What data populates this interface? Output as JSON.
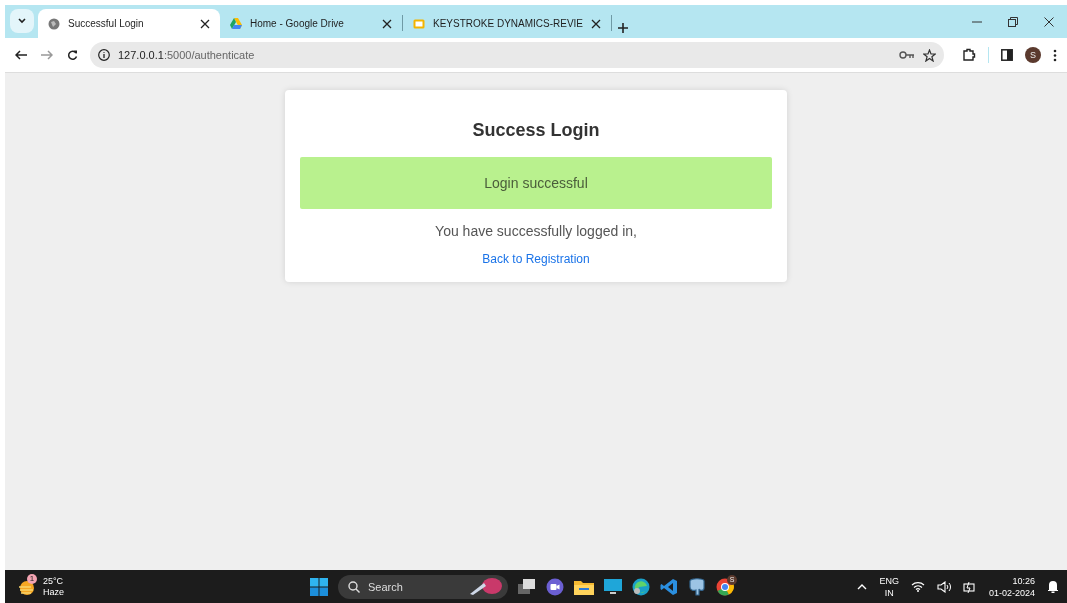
{
  "browser": {
    "tabs": [
      {
        "title": "Successful Login",
        "kind": "globe",
        "selected": true
      },
      {
        "title": "Home - Google Drive",
        "kind": "drive",
        "selected": false
      },
      {
        "title": "KEYSTROKE DYNAMICS-REVIE",
        "kind": "slides",
        "selected": false
      }
    ],
    "address": {
      "host": "127.0.0.1",
      "path": ":5000/authenticate"
    },
    "profile_initial": "S"
  },
  "page": {
    "heading": "Success Login",
    "alert": "Login successful",
    "message": "You have successfully logged in,",
    "link": "Back to Registration"
  },
  "taskbar": {
    "weather": {
      "temp": "25°C",
      "condition": "Haze",
      "badge": "1"
    },
    "search_placeholder": "Search",
    "chrome_badge": "S",
    "language": {
      "code": "ENG",
      "region": "IN"
    },
    "time": "10:26",
    "date": "01-02-2024"
  }
}
